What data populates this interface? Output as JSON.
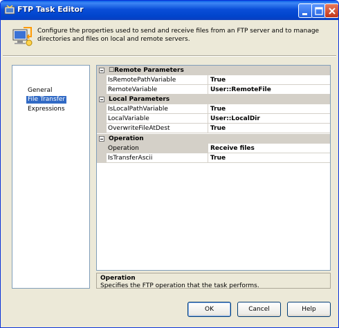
{
  "window": {
    "title": "FTP Task Editor"
  },
  "header": {
    "description": "Configure the properties used to send and receive files from an FTP server and to manage directories and files on local and remote servers."
  },
  "nav": {
    "items": [
      {
        "label": "General"
      },
      {
        "label": "File Transfer",
        "selected": true
      },
      {
        "label": "Expressions"
      }
    ]
  },
  "grid": {
    "categories": [
      {
        "label": "☐Remote Parameters",
        "properties": [
          {
            "name": "IsRemotePathVariable",
            "value": "True"
          },
          {
            "name": "RemoteVariable",
            "value": "User::RemoteFile"
          }
        ]
      },
      {
        "label": "Local Parameters",
        "properties": [
          {
            "name": "IsLocalPathVariable",
            "value": "True"
          },
          {
            "name": "LocalVariable",
            "value": "User::LocalDir"
          },
          {
            "name": "OverwriteFileAtDest",
            "value": "True"
          }
        ]
      },
      {
        "label": "Operation",
        "properties": [
          {
            "name": "Operation",
            "value": "Receive files",
            "selected": true
          },
          {
            "name": "IsTransferAscii",
            "value": "True"
          }
        ]
      }
    ]
  },
  "description_panel": {
    "title": "Operation",
    "text": "Specifies the FTP operation that the task performs."
  },
  "buttons": {
    "ok": "OK",
    "cancel": "Cancel",
    "help": "Help"
  },
  "colors": {
    "titlebar": "#0a4ed8",
    "selection": "#316ac5",
    "category_background": "#d4d0c8"
  }
}
